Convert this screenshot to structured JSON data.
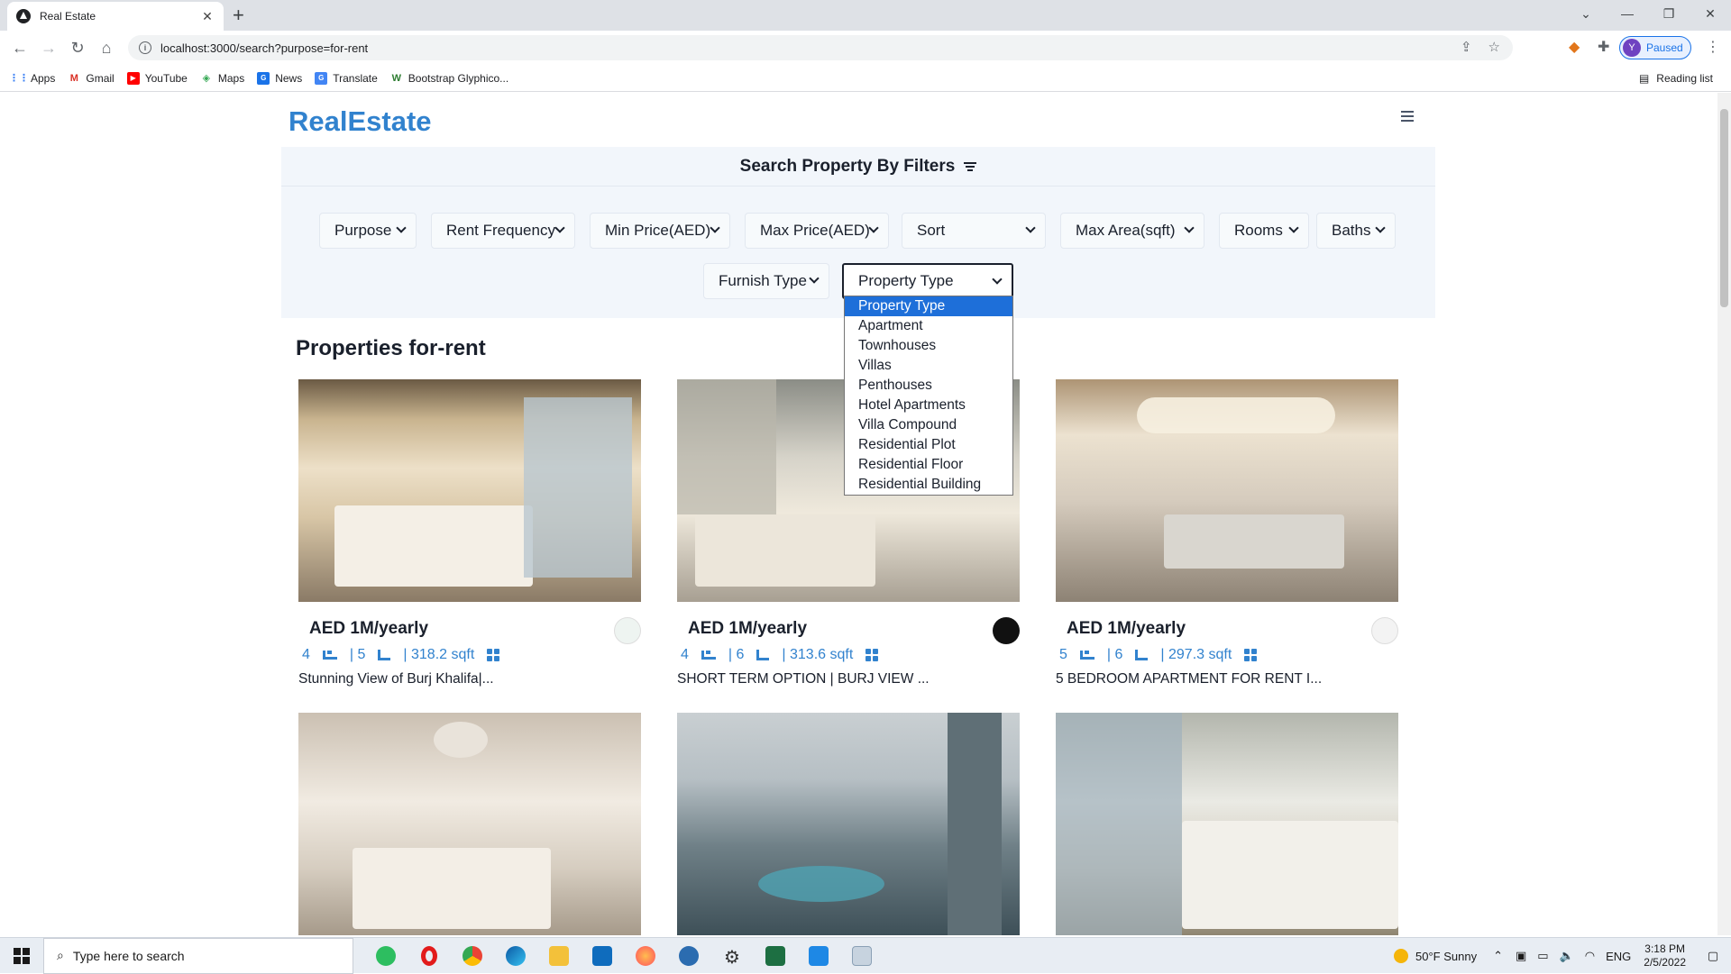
{
  "browser": {
    "tab_title": "Real Estate",
    "tab_close": "✕",
    "new_tab": "+",
    "url": "localhost:3000/search?purpose=for-rent",
    "profile_initial": "Y",
    "profile_label": "Paused",
    "bookmarks": [
      {
        "label": "Apps",
        "icon": "apps-grid-icon",
        "color": "#4285f4"
      },
      {
        "label": "Gmail",
        "icon": "gmail-icon",
        "color": "#d93025"
      },
      {
        "label": "YouTube",
        "icon": "youtube-icon",
        "color": "#ff0000"
      },
      {
        "label": "Maps",
        "icon": "maps-icon",
        "color": "#34a853"
      },
      {
        "label": "News",
        "icon": "news-icon",
        "color": "#1a73e8"
      },
      {
        "label": "Translate",
        "icon": "translate-icon",
        "color": "#4285f4"
      },
      {
        "label": "Bootstrap Glyphico...",
        "icon": "w-icon",
        "color": "#2e7d32"
      }
    ],
    "reading_list": "Reading list"
  },
  "page": {
    "brand": "RealEstate",
    "filters_title": "Search Property By Filters",
    "filters_row1": [
      "Purpose",
      "Rent Frequency",
      "Min Price(AED)",
      "Max Price(AED)",
      "Sort",
      "Max Area(sqft)",
      "Rooms",
      "Baths"
    ],
    "filters_row2": [
      "Furnish Type",
      "Property Type"
    ],
    "dropdown_options": [
      "Property Type",
      "Apartment",
      "Townhouses",
      "Villas",
      "Penthouses",
      "Hotel Apartments",
      "Villa Compound",
      "Residential Plot",
      "Residential Floor",
      "Residential Building"
    ],
    "section_title": "Properties for-rent",
    "cards": [
      {
        "price": "AED 1M/yearly",
        "rooms": "4",
        "baths": "| 5",
        "area": "| 318.2 sqft",
        "title": "Stunning View of Burj Khalifa|..."
      },
      {
        "price": "AED 1M/yearly",
        "rooms": "4",
        "baths": "| 6",
        "area": "| 313.6 sqft",
        "title": "SHORT TERM OPTION | BURJ VIEW ..."
      },
      {
        "price": "AED 1M/yearly",
        "rooms": "5",
        "baths": "| 6",
        "area": "| 297.3 sqft",
        "title": "5 BEDROOM APARTMENT FOR RENT I..."
      }
    ]
  },
  "taskbar": {
    "search_placeholder": "Type here to search",
    "weather": "50°F  Sunny",
    "lang": "ENG",
    "time": "3:18 PM",
    "date": "2/5/2022"
  }
}
